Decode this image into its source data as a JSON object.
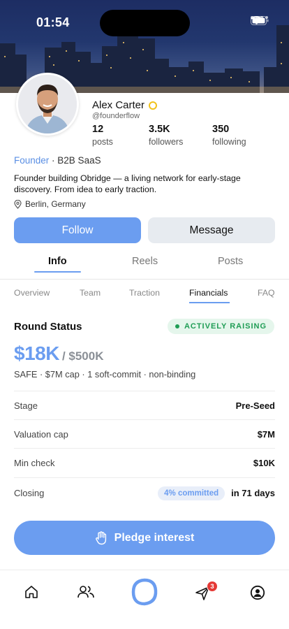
{
  "status_bar": {
    "time": "01:54"
  },
  "profile": {
    "name": "Alex Carter",
    "handle": "@founderflow",
    "stats": [
      {
        "value": "12",
        "label": "posts"
      },
      {
        "value": "3.5K",
        "label": "followers"
      },
      {
        "value": "350",
        "label": "following"
      }
    ],
    "role": "Founder",
    "role_rest": " · B2B SaaS",
    "bio": "Founder building Obridge — a living network for early-stage discovery. From idea to early traction.",
    "location": "Berlin, Germany"
  },
  "actions": {
    "follow_label": "Follow",
    "message_label": "Message"
  },
  "main_tabs": [
    "Info",
    "Reels",
    "Posts"
  ],
  "sub_tabs": [
    "Overview",
    "Team",
    "Traction",
    "Financials",
    "FAQ"
  ],
  "round": {
    "title": "Round Status",
    "status_badge": "ACTIVELY RAISING",
    "raised": "$18K",
    "target": "/ $500K",
    "terms": "SAFE · $7M cap · 1 soft-commit · non-binding",
    "rows": [
      {
        "label": "Stage",
        "value": "Pre-Seed"
      },
      {
        "label": "Valuation cap",
        "value": "$7M"
      },
      {
        "label": "Min check",
        "value": "$10K"
      },
      {
        "label": "Closing",
        "value": "in 71 days",
        "pill": "4% committed"
      }
    ]
  },
  "cta": {
    "label": "Pledge interest",
    "icon": "hand-icon"
  },
  "tab_bar": {
    "items": [
      "home-icon",
      "people-icon",
      "logo-icon",
      "send-icon",
      "profile-icon"
    ],
    "send_badge": "3"
  },
  "colors": {
    "accent": "#6b9df0",
    "raising_green": "#1f9d55",
    "badge_red": "#e53935"
  }
}
